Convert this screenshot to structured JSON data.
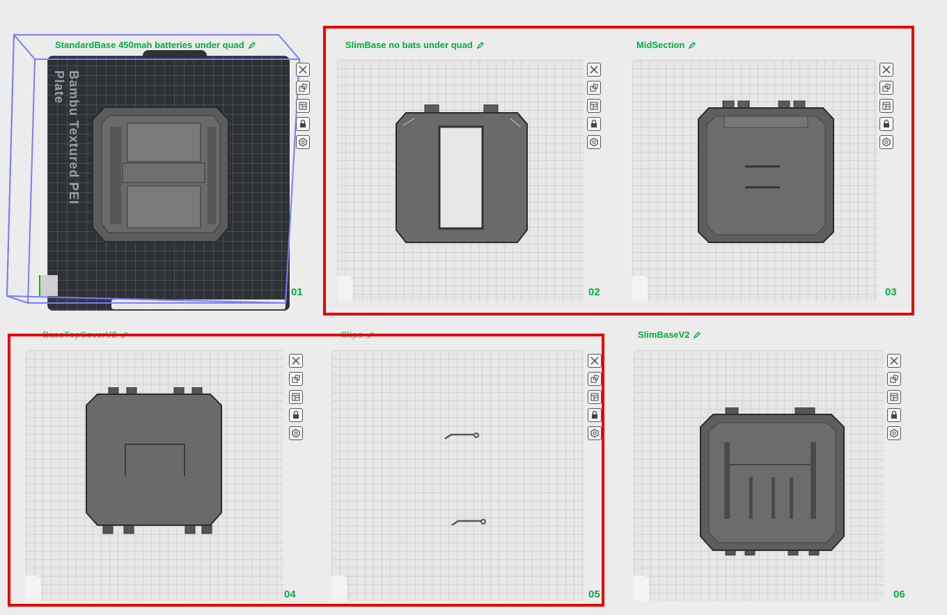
{
  "plates": [
    {
      "title": "StandardBase 450mah batteries under quad",
      "number": "01",
      "bed_text": "Bambu Textured PEI Plate"
    },
    {
      "title": "SlimBase no bats under quad",
      "number": "02"
    },
    {
      "title": "MidSection",
      "number": "03"
    },
    {
      "title": "BaseTopCoverV2",
      "number": "04"
    },
    {
      "title": "Clips",
      "number": "05"
    },
    {
      "title": "SlimBaseV2",
      "number": "06"
    }
  ],
  "toolbar_icons": [
    "close-icon",
    "arrange-icon",
    "layout-icon",
    "lock-icon",
    "settings-icon"
  ],
  "colors": {
    "accent": "#00ae42",
    "highlight": "#e60000",
    "selection": "#7b7bff"
  }
}
